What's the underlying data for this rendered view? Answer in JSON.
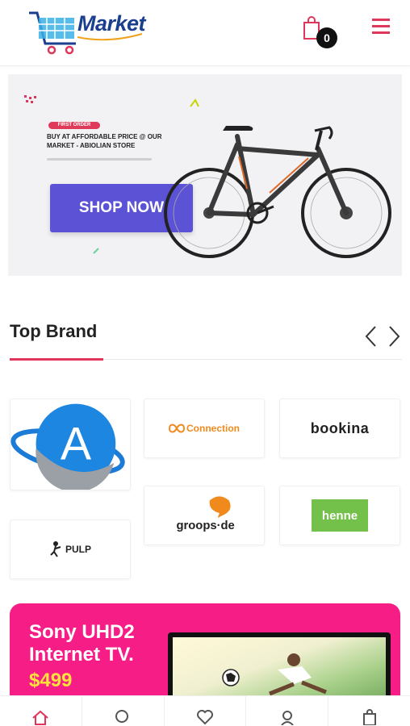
{
  "header": {
    "logo_text": "Market",
    "cart_count": "0"
  },
  "hero": {
    "tag": "FIRST ORDER",
    "title": "BUY AT AFFORDABLE PRICE @ OUR MARKET - ABIOLIAN STORE",
    "button_label": "SHOP NOW"
  },
  "brands": {
    "title": "Top Brand",
    "items": [
      {
        "name": "A"
      },
      {
        "name": "Connection"
      },
      {
        "name": "bookina"
      },
      {
        "name": "PULP"
      },
      {
        "name": "groops·de"
      },
      {
        "name": "henne"
      }
    ]
  },
  "promo": {
    "title": "Sony UHD2 Internet TV.",
    "price": "$499"
  },
  "colors": {
    "accent": "#e0365b",
    "button": "#5b52d6",
    "promo_bg": "#f61e86",
    "price": "#ffe23b"
  },
  "bottom_nav": [
    "home-icon",
    "search-icon",
    "heart-icon",
    "user-icon",
    "bag-icon"
  ]
}
